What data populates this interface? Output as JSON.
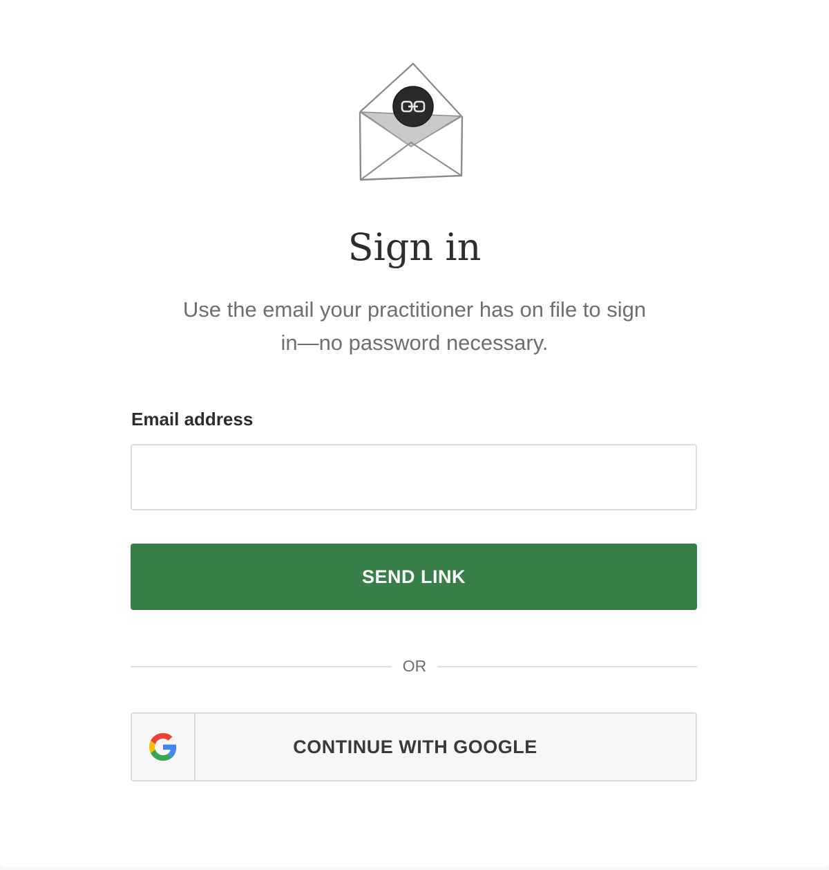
{
  "illustration": {
    "name": "envelope-link-illustration"
  },
  "header": {
    "title": "Sign in",
    "subtitle": "Use the email your practitioner has on file to sign in—no password necessary."
  },
  "form": {
    "email_label": "Email address",
    "email_value": "",
    "email_placeholder": "",
    "submit_label": "SEND LINK"
  },
  "divider": {
    "label": "OR"
  },
  "social": {
    "google_label": "CONTINUE WITH GOOGLE",
    "google_icon": "google-g-icon"
  },
  "colors": {
    "primary": "#377e49",
    "text": "#2d2d2d",
    "muted": "#6f6f6f",
    "border": "#dcdcdc"
  }
}
